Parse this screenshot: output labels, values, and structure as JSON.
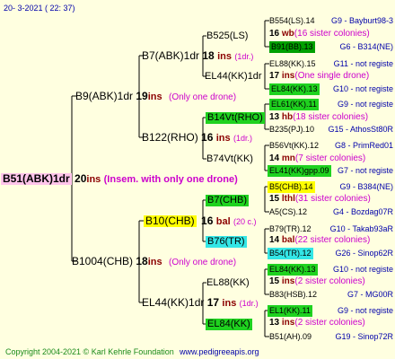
{
  "header": {
    "date": "20- 3-2021 ( 22: 37)"
  },
  "root": {
    "name": "B51(ABK)1dr",
    "num": "20",
    "ins": "ins",
    "note": "(Insem. with only one drone)"
  },
  "p1": {
    "name": "B9(ABK)1dr",
    "num": "19",
    "ins": "ins",
    "note": "(Only one drone)"
  },
  "p2": {
    "name": "B1004(CHB)",
    "num": "18",
    "ins": "ins",
    "note": "(Only one drone)"
  },
  "gp1": {
    "name": "B7(ABK)1dr",
    "num": "18",
    "ins": "ins",
    "note": "(1dr.)"
  },
  "gp2": {
    "name": "B122(RHO)",
    "num": "16",
    "ins": "ins",
    "note": "(1dr.)"
  },
  "gp3": {
    "name": "B10(CHB)",
    "num": "16",
    "ins": "bal",
    "note": "(20 c.)"
  },
  "gp4": {
    "name": "EL44(KK)1dr",
    "num": "17",
    "ins": "ins",
    "note": "(1dr.)"
  },
  "g3": [
    {
      "name": "B525(LS)",
      "num": "16",
      "ins": "wb",
      "note": "(16 sister colonies)"
    },
    {
      "name": "EL44(KK)1dr",
      "num": "17",
      "ins": "ins",
      "note": "(One single drone)"
    },
    {
      "name": "B14Vt(RHO)",
      "num": "13",
      "ins": "hb",
      "note": "(18 sister colonies)"
    },
    {
      "name": "B74Vt(KK)",
      "num": "14",
      "ins": "mn",
      "note": "(7 sister colonies)"
    },
    {
      "name": "B7(CHB)",
      "num": "15",
      "ins": "lthl",
      "note": "(31 sister colonies)"
    },
    {
      "name": "B76(TR)",
      "num": "14",
      "ins": "bal",
      "note": "(22 sister colonies)"
    },
    {
      "name": "EL88(KK)",
      "num": "15",
      "ins": "ins",
      "note": "(2 sister colonies)"
    },
    {
      "name": "EL84(KK)",
      "num": "13",
      "ins": "ins",
      "note": "(2 sister colonies)"
    }
  ],
  "g4": [
    {
      "name": "B554(LS).14",
      "code": "G9 - Bayburt98-3"
    },
    {
      "name": "B91(BB).13",
      "code": "G6 - B314(NE)"
    },
    {
      "name": "EL88(KK).15",
      "code": "G11 - not registe"
    },
    {
      "name": "EL84(KK).13",
      "code": "G10 - not registe"
    },
    {
      "name": "EL61(KK).11",
      "code": "G9 - not registe"
    },
    {
      "name": "B235(PJ).10",
      "code": "G15 - AthosSt80R"
    },
    {
      "name": "B56Vt(KK).12",
      "code": "G8 - PrimRed01"
    },
    {
      "name": "EL41(KK)gpp.09",
      "code": "G7 - not registe"
    },
    {
      "name": "B5(CHB).14",
      "code": "G9 - B384(NE)"
    },
    {
      "name": "A5(CS).12",
      "code": "G4 - Bozdag07R"
    },
    {
      "name": "B79(TR).12",
      "code": "G10 - Takab93aR"
    },
    {
      "name": "B54(TR).12",
      "code": "G26 - Sinop62R"
    },
    {
      "name": "EL84(KK).13",
      "code": "G10 - not registe"
    },
    {
      "name": "B83(HSB).12",
      "code": "G7 - MG00R"
    },
    {
      "name": "EL1(KK).11",
      "code": "G9 - not registe"
    },
    {
      "name": "B51(AH).09",
      "code": "G19 - Sinop72R"
    }
  ],
  "footer": {
    "copyright": "Copyright 2004-2021 © Karl Kehrle Foundation",
    "site": "www.pedigreeapis.org"
  }
}
